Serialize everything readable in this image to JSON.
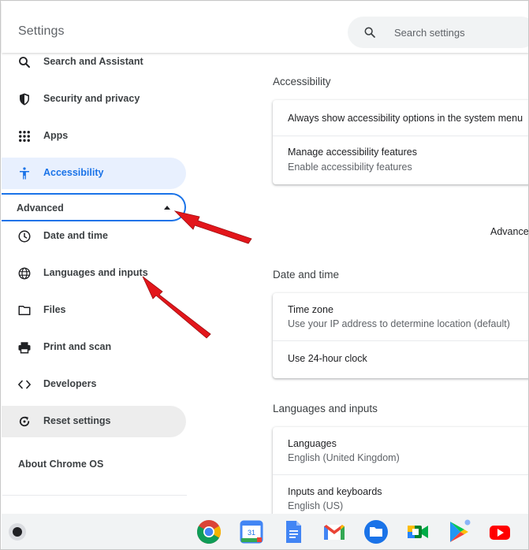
{
  "header": {
    "title": "Settings",
    "search_placeholder": "Search settings",
    "search_icon": "search-icon"
  },
  "sidebar": {
    "items": [
      {
        "label": "Search and Assistant",
        "icon": "search-icon"
      },
      {
        "label": "Security and privacy",
        "icon": "shield-icon"
      },
      {
        "label": "Apps",
        "icon": "apps-grid-icon"
      },
      {
        "label": "Accessibility",
        "icon": "accessibility-icon",
        "active": true
      },
      {
        "label": "Date and time",
        "icon": "clock-icon"
      },
      {
        "label": "Languages and inputs",
        "icon": "globe-icon"
      },
      {
        "label": "Files",
        "icon": "folder-icon"
      },
      {
        "label": "Print and scan",
        "icon": "printer-icon"
      },
      {
        "label": "Developers",
        "icon": "code-icon"
      },
      {
        "label": "Reset settings",
        "icon": "reset-icon"
      }
    ],
    "advanced_label": "Advanced",
    "about_label": "About Chrome OS"
  },
  "main": {
    "accessibility": {
      "title": "Accessibility",
      "rows": [
        {
          "title": "Always show accessibility options in the system menu"
        },
        {
          "title": "Manage accessibility features",
          "subtitle": "Enable accessibility features"
        }
      ]
    },
    "advanced_label": "Advanced",
    "date_time": {
      "title": "Date and time",
      "rows": [
        {
          "title": "Time zone",
          "subtitle": "Use your IP address to determine location (default)"
        },
        {
          "title": "Use 24-hour clock"
        }
      ]
    },
    "languages": {
      "title": "Languages and inputs",
      "rows": [
        {
          "title": "Languages",
          "subtitle": "English (United Kingdom)"
        },
        {
          "title": "Inputs and keyboards",
          "subtitle": "English (US)"
        }
      ]
    }
  },
  "shelf": {
    "apps": [
      "chrome-icon",
      "calendar-icon",
      "docs-icon",
      "gmail-icon",
      "files-icon",
      "meet-icon",
      "play-store-icon",
      "youtube-icon"
    ],
    "calendar_day": "31"
  },
  "colors": {
    "accent": "#1a73e8",
    "active_bg": "#e8f0fe",
    "arrow": "#e3161b"
  }
}
